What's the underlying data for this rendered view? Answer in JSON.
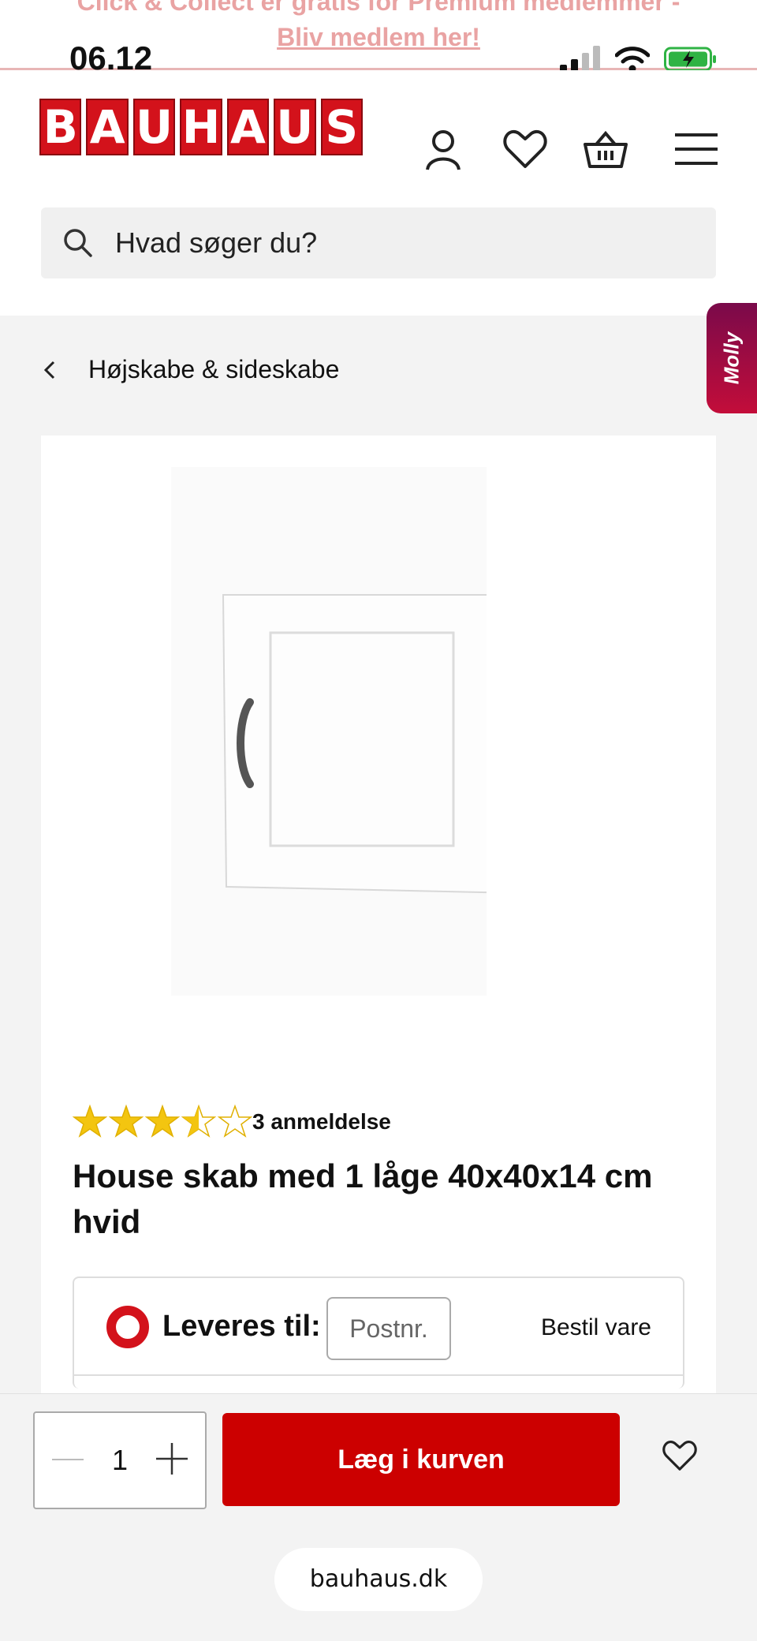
{
  "promo": {
    "line1": "Click & Collect er gratis for Premium medlemmer -",
    "line2": "Bliv medlem her!"
  },
  "status_bar": {
    "time": "06.12"
  },
  "header": {
    "logo_letters": [
      "B",
      "A",
      "U",
      "H",
      "A",
      "U",
      "S"
    ],
    "icons": [
      "user-icon",
      "heart-icon",
      "basket-icon",
      "menu-icon"
    ]
  },
  "search": {
    "placeholder": "Hvad søger du?"
  },
  "breadcrumb": {
    "label": "Højskabe & sideskabe"
  },
  "molly": {
    "label": "Molly"
  },
  "product": {
    "rating": 3.5,
    "rating_max": 5,
    "reviews_text": "3 anmeldelse",
    "title": "House skab med 1 låge 40x40x14 cm hvid"
  },
  "delivery": {
    "label": "Leveres til:",
    "postnr_placeholder": "Postnr.",
    "order_text": "Bestil vare"
  },
  "cart_bar": {
    "quantity": "1",
    "add_to_cart": "Læg i kurven"
  },
  "browser": {
    "url": "bauhaus.dk"
  },
  "colors": {
    "brand_red": "#d3121b",
    "button_red": "#cc0000"
  }
}
